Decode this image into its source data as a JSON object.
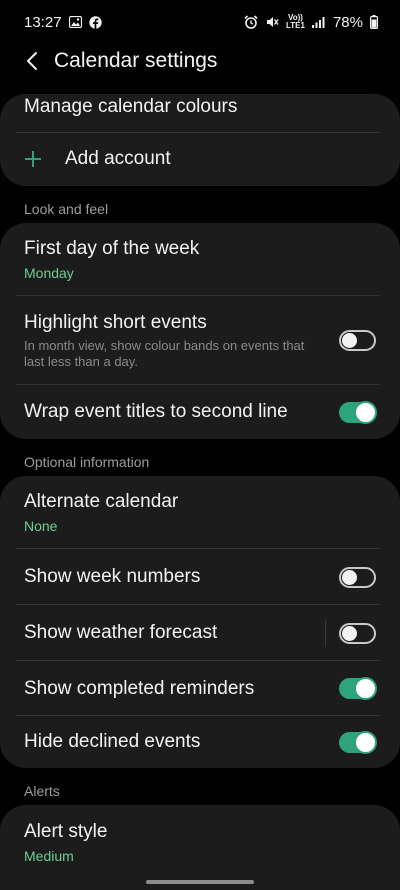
{
  "status": {
    "time": "13:27",
    "network_top": "Vo))",
    "network_bottom": "LTE1",
    "battery": "78%"
  },
  "header": {
    "title": "Calendar settings"
  },
  "top_card": {
    "manage_colours": "Manage calendar colours",
    "add_account": "Add account"
  },
  "look_and_feel": {
    "label": "Look and feel",
    "first_day_title": "First day of the week",
    "first_day_value": "Monday",
    "highlight_title": "Highlight short events",
    "highlight_desc": "In month view, show colour bands on events that last less than a day.",
    "highlight_on": false,
    "wrap_title": "Wrap event titles to second line",
    "wrap_on": true
  },
  "optional_info": {
    "label": "Optional information",
    "alt_calendar_title": "Alternate calendar",
    "alt_calendar_value": "None",
    "week_numbers_title": "Show week numbers",
    "week_numbers_on": false,
    "weather_title": "Show weather forecast",
    "weather_on": false,
    "completed_title": "Show completed reminders",
    "completed_on": true,
    "declined_title": "Hide declined events",
    "declined_on": true
  },
  "alerts": {
    "label": "Alerts",
    "alert_style_title": "Alert style",
    "alert_style_value": "Medium"
  },
  "colors": {
    "accent": "#2fa37b",
    "value_text": "#6dcd96",
    "card_bg": "#1c1c1c",
    "background": "#010101"
  }
}
